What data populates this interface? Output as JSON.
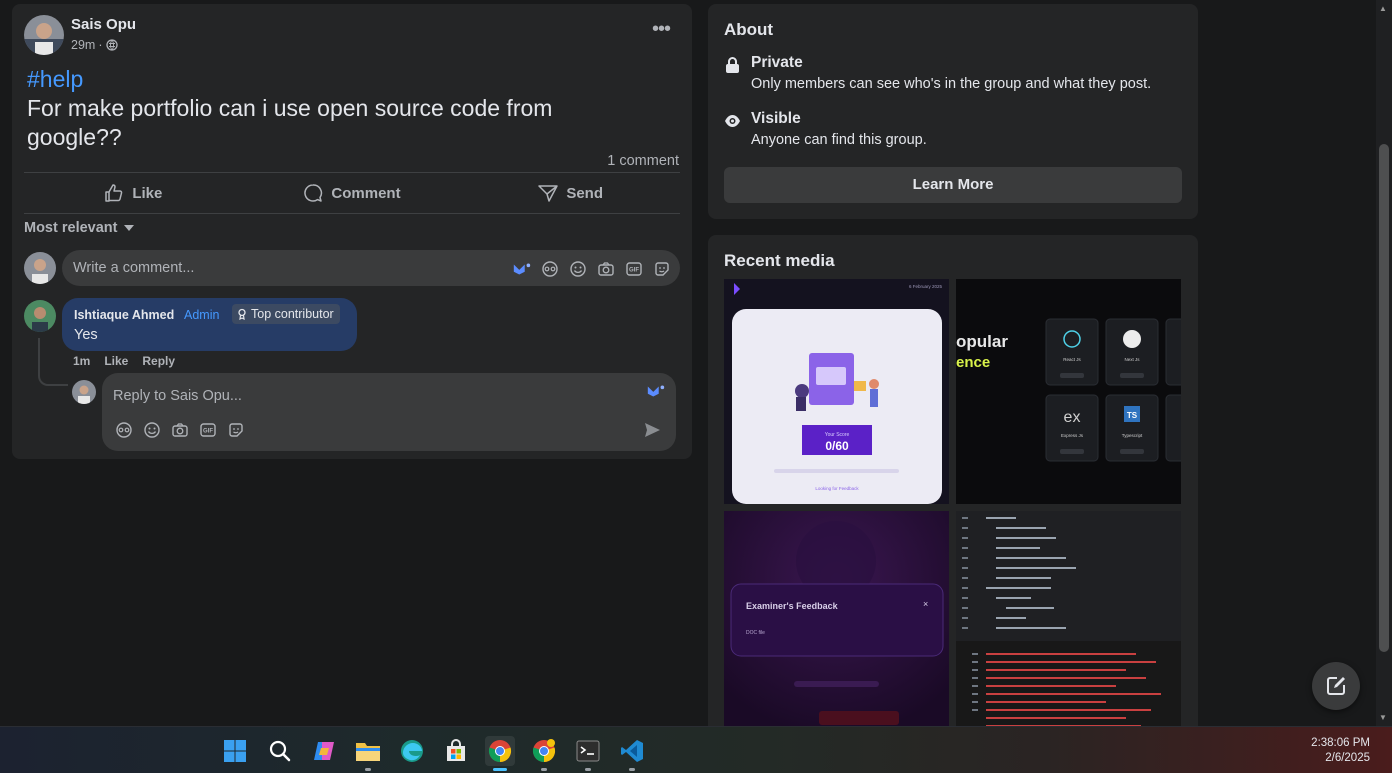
{
  "post": {
    "author": "Sais Opu",
    "time": "29m",
    "privacy_sep": "·",
    "more_label": "•••",
    "hashtag": "#help",
    "text": "For make portfolio can i use open source code from google??",
    "comment_count": "1 comment",
    "actions": {
      "like": "Like",
      "comment": "Comment",
      "send": "Send"
    },
    "sort_label": "Most relevant",
    "comment_placeholder": "Write a comment..."
  },
  "comments": [
    {
      "author": "Ishtiaque Ahmed",
      "role": "Admin",
      "badge": "Top contributor",
      "text": "Yes",
      "time": "1m",
      "like": "Like",
      "reply": "Reply"
    }
  ],
  "reply": {
    "placeholder": "Reply to Sais Opu..."
  },
  "about": {
    "title": "About",
    "private_title": "Private",
    "private_desc": "Only members can see who's in the group and what they post.",
    "visible_title": "Visible",
    "visible_desc": "Anyone can find this group.",
    "learn_more": "Learn More"
  },
  "media": {
    "title": "Recent media",
    "tile1": {
      "date": "6 February 2025",
      "score_label": "Your Score",
      "score": "0/60",
      "review_link": "Looking for Feedback"
    },
    "tile2": {
      "heading_1": "opular",
      "heading_2": "ence",
      "cards": [
        "React Js",
        "Next Js",
        "Express Js",
        "Typescript"
      ],
      "short_labels": [
        "ex",
        "TS"
      ]
    },
    "tile3": {
      "dialog_title": "Examiner's Feedback",
      "dialog_body": "DOC file",
      "close": "×"
    },
    "tile4": {
      "kind": "code-editor"
    }
  },
  "taskbar": {
    "time": "2:38:06 PM",
    "date": "2/6/2025",
    "apps": [
      "start-icon",
      "search-icon",
      "copilot-icon",
      "file-explorer-icon",
      "edge-icon",
      "store-icon",
      "chrome-icon",
      "chrome-canary-icon",
      "terminal-icon",
      "vscode-icon"
    ]
  },
  "colors": {
    "accent": "#4599ff",
    "bubble": "#263c66",
    "card": "#242526",
    "background": "#18191a"
  }
}
